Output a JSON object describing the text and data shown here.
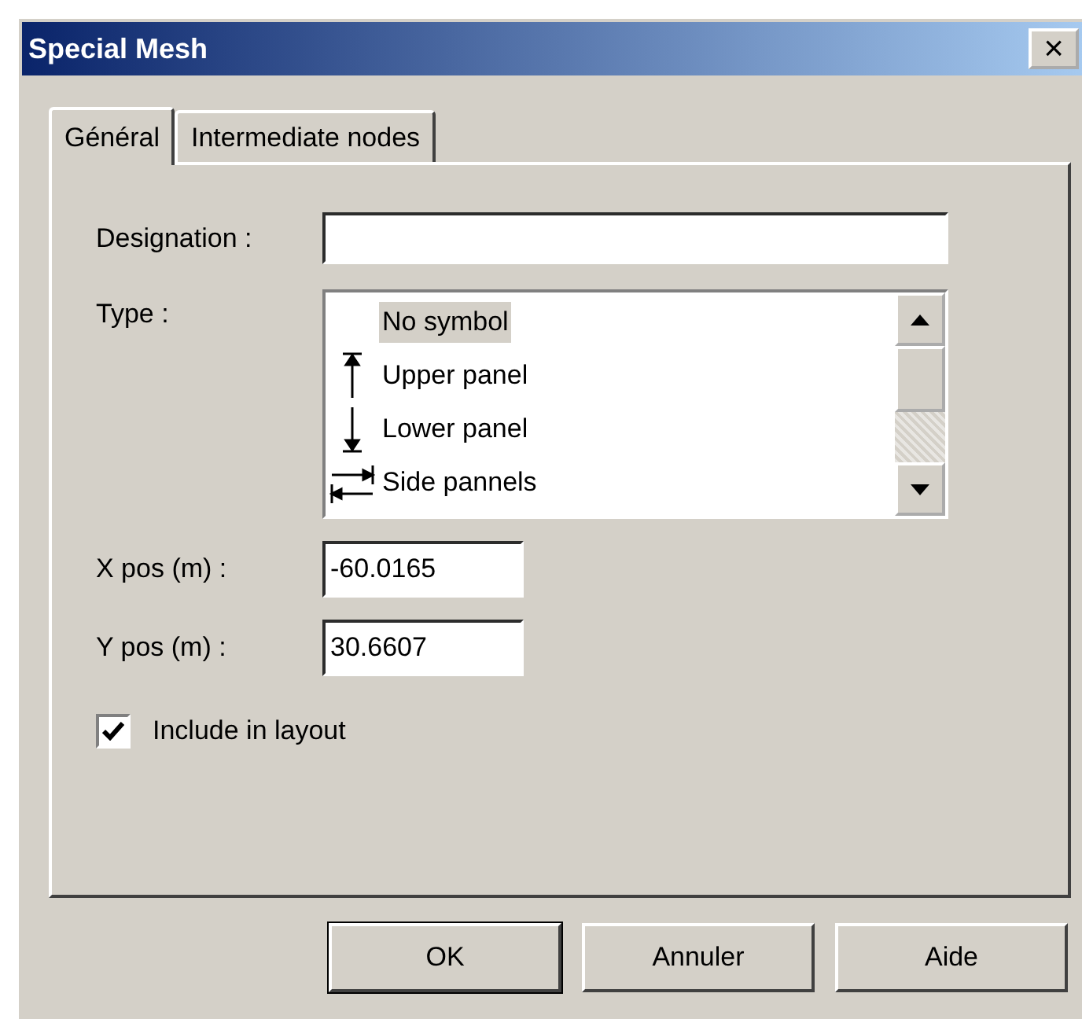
{
  "window": {
    "title": "Special Mesh",
    "close": "×"
  },
  "tabs": [
    {
      "label": "Général",
      "selected": true
    },
    {
      "label": "Intermediate nodes",
      "selected": false
    }
  ],
  "designation": {
    "label": "Designation :"
  },
  "type": {
    "label": "Type :",
    "items": [
      {
        "label": "No symbol",
        "kind": "none",
        "selected": true
      },
      {
        "label": "Upper panel",
        "kind": "upper",
        "selected": false
      },
      {
        "label": "Lower panel",
        "kind": "lower",
        "selected": false
      },
      {
        "label": "Side pannels",
        "kind": "side",
        "selected": false
      }
    ]
  },
  "x_pos": {
    "label": "X pos (m) :",
    "value": "-60.0165"
  },
  "y_pos": {
    "label": "Y pos (m) :",
    "value": "30.6607"
  },
  "include": {
    "label": "Include in layout",
    "checked": true
  },
  "buttons": [
    {
      "label": "OK",
      "default": true
    },
    {
      "label": "Annuler",
      "default": false
    },
    {
      "label": "Aide",
      "default": false
    }
  ]
}
